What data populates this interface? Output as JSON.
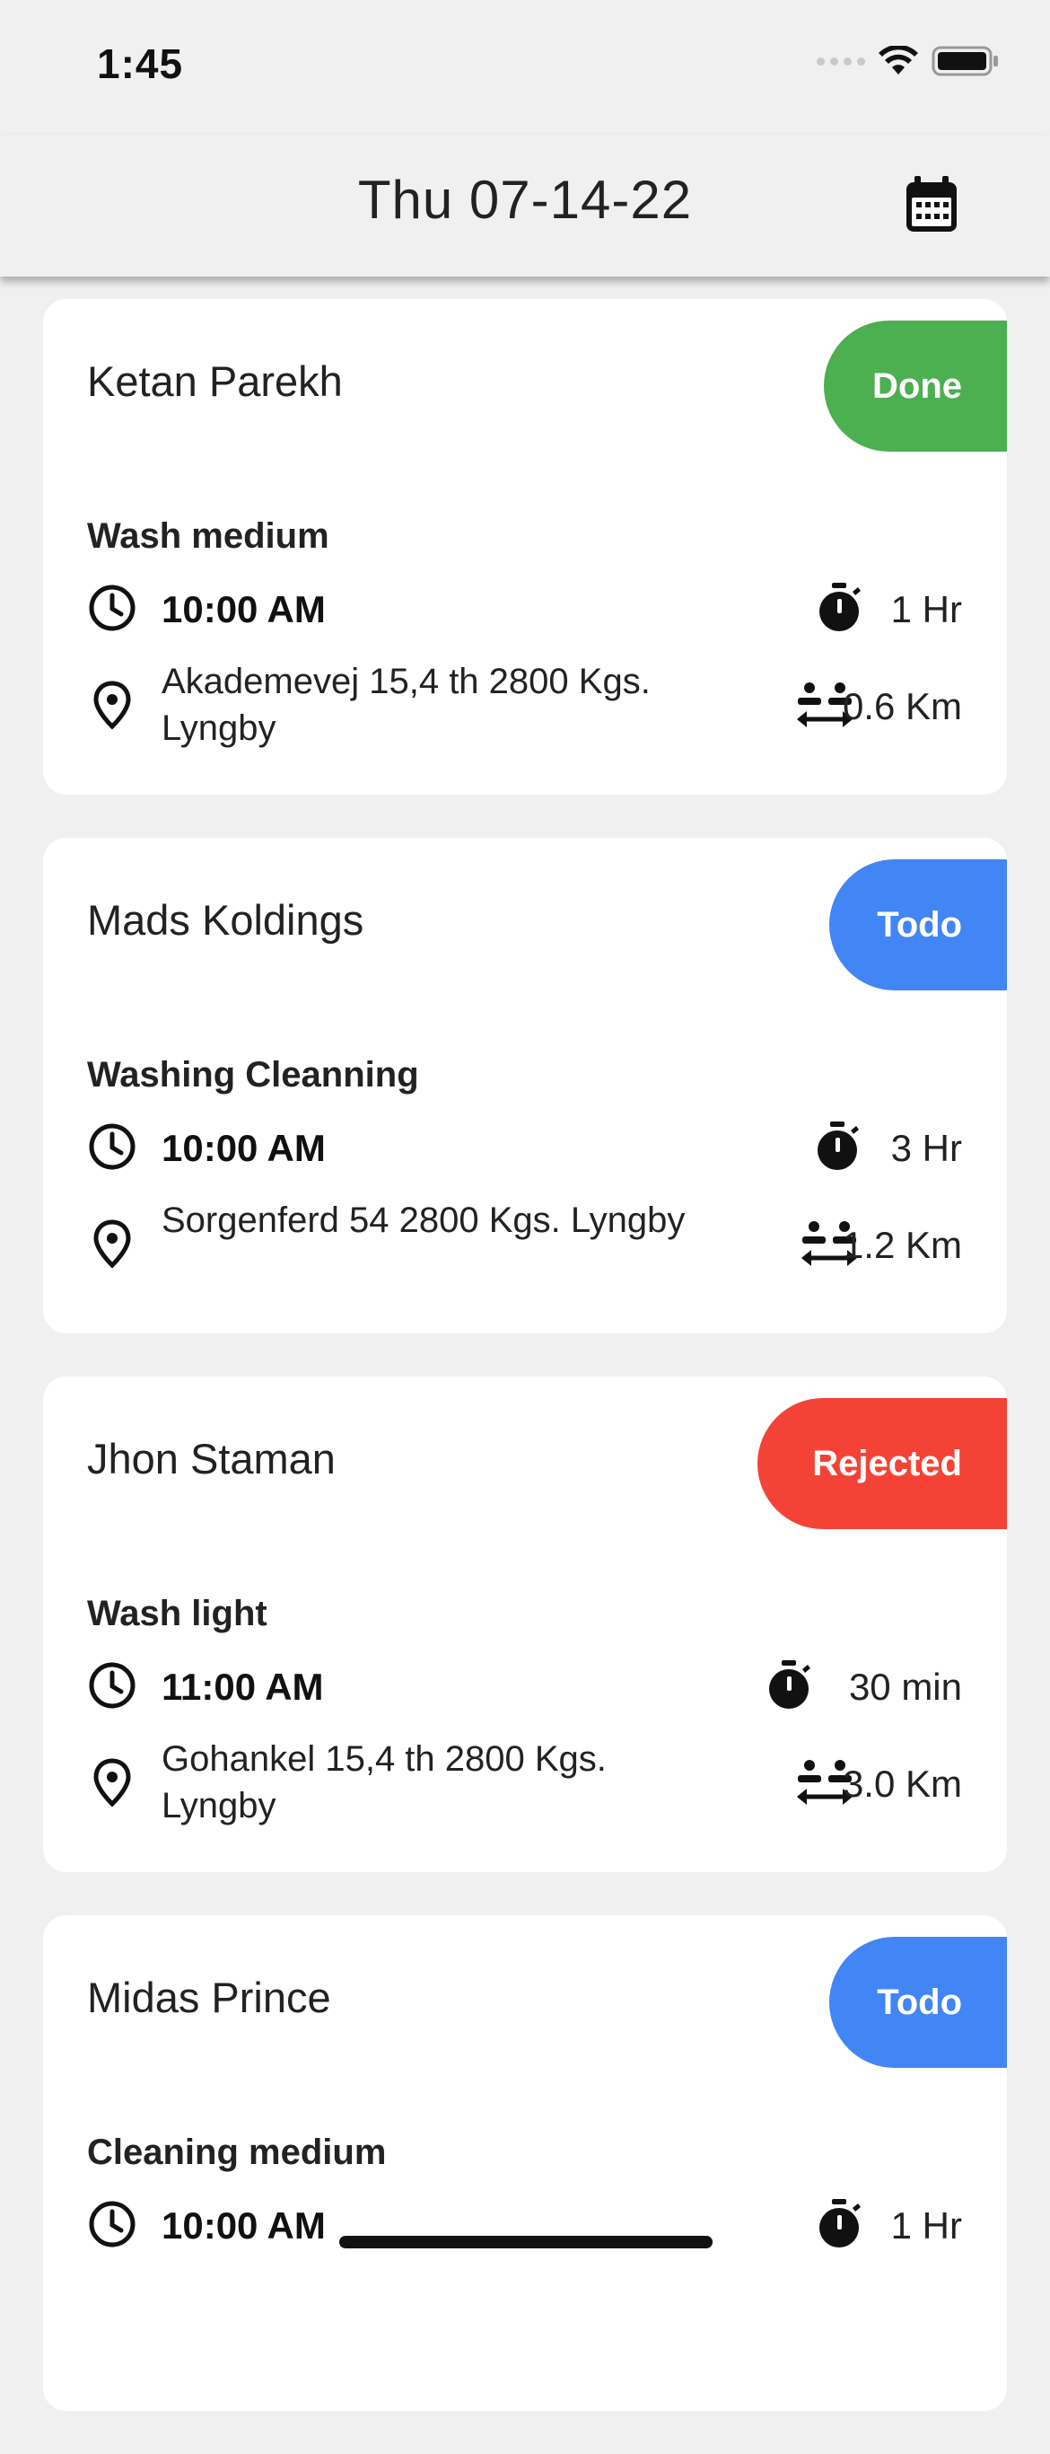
{
  "status_bar": {
    "time": "1:45"
  },
  "header": {
    "title": "Thu 07-14-22"
  },
  "colors": {
    "done": "#4caf50",
    "todo": "#4285f4",
    "rejected": "#f44336"
  },
  "jobs": [
    {
      "customer": "Ketan Parekh",
      "status": "Done",
      "service": "Wash medium",
      "time": "10:00 AM",
      "address": "Akademevej 15,4 th 2800 Kgs. Lyngby",
      "duration": "1 Hr",
      "distance": "0.6 Km"
    },
    {
      "customer": "Mads Koldings",
      "status": "Todo",
      "service": "Washing Cleanning",
      "time": "10:00 AM",
      "address": "Sorgenferd 54 2800 Kgs. Lyngby",
      "duration": "3 Hr",
      "distance": "1.2 Km"
    },
    {
      "customer": "Jhon Staman",
      "status": "Rejected",
      "service": "Wash light",
      "time": "11:00 AM",
      "address": "Gohankel 15,4 th 2800 Kgs. Lyngby",
      "duration": "30 min",
      "distance": "3.0 Km"
    },
    {
      "customer": "Midas Prince",
      "status": "Todo",
      "service": "Cleaning medium",
      "time": "10:00 AM",
      "address": "",
      "duration": "1 Hr",
      "distance": ""
    }
  ]
}
